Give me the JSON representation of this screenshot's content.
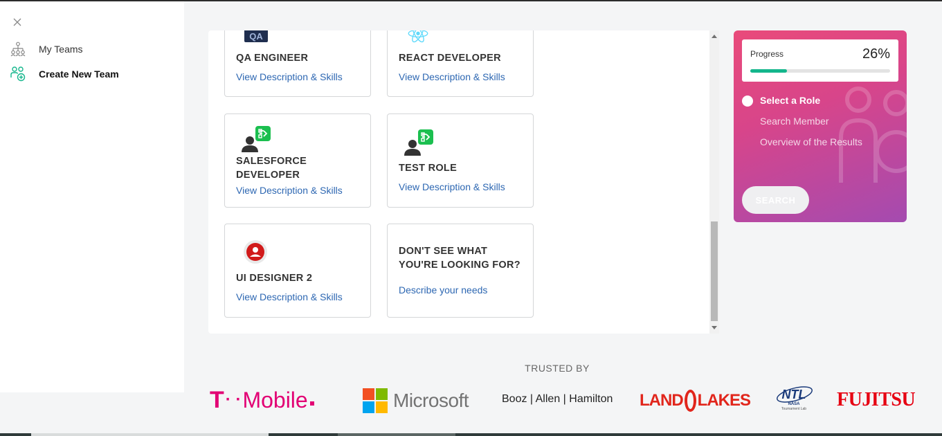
{
  "sidebar": {
    "items": [
      {
        "label": "My Teams",
        "icon": "team-hierarchy-icon"
      },
      {
        "label": "Create New Team",
        "icon": "add-team-icon"
      }
    ]
  },
  "roles": [
    {
      "title": "QA ENGINEER",
      "link": "View Description & Skills",
      "icon": "qa-icon",
      "icon_text": "QA"
    },
    {
      "title": "REACT DEVELOPER",
      "link": "View Description & Skills",
      "icon": "react-icon"
    },
    {
      "title": "SALESFORCE DEVELOPER",
      "link": "View Description & Skills",
      "icon": "developer-role-icon"
    },
    {
      "title": "TEST ROLE",
      "link": "View Description & Skills",
      "icon": "developer-role-icon"
    },
    {
      "title": "UI DESIGNER 2",
      "link": "View Description & Skills",
      "icon": "designer-role-icon"
    },
    {
      "title": "DON'T SEE WHAT YOU'RE LOOKING FOR?",
      "link": "Describe your needs"
    }
  ],
  "progress": {
    "label": "Progress",
    "value_text": "26%",
    "value": 0.26,
    "accent": "#14b68c"
  },
  "steps": [
    "Select a Role",
    "Search Member",
    "Overview of the Results"
  ],
  "search_button": "SEARCH",
  "trusted_by": {
    "heading": "TRUSTED BY",
    "logos": [
      {
        "name": "T-Mobile",
        "text_left": "T",
        "dots": "· ·",
        "text_right": "Mobile",
        "color": "#e20074"
      },
      {
        "name": "Microsoft",
        "text": "Microsoft",
        "color": "#737373"
      },
      {
        "name": "Booz Allen Hamilton",
        "text": "Booz | Allen | Hamilton",
        "color": "#222222"
      },
      {
        "name": "Land O Lakes",
        "text_left": "LAND",
        "text_right": "LAKES",
        "color": "#e1261c"
      },
      {
        "name": "NTL NASA Tournament Lab",
        "text": "NTL",
        "sub1": "NASA",
        "sub2": "Tournament Lab",
        "color": "#1a3a7a"
      },
      {
        "name": "Fujitsu",
        "text": "FUJITSU",
        "color": "#e60012"
      }
    ]
  }
}
